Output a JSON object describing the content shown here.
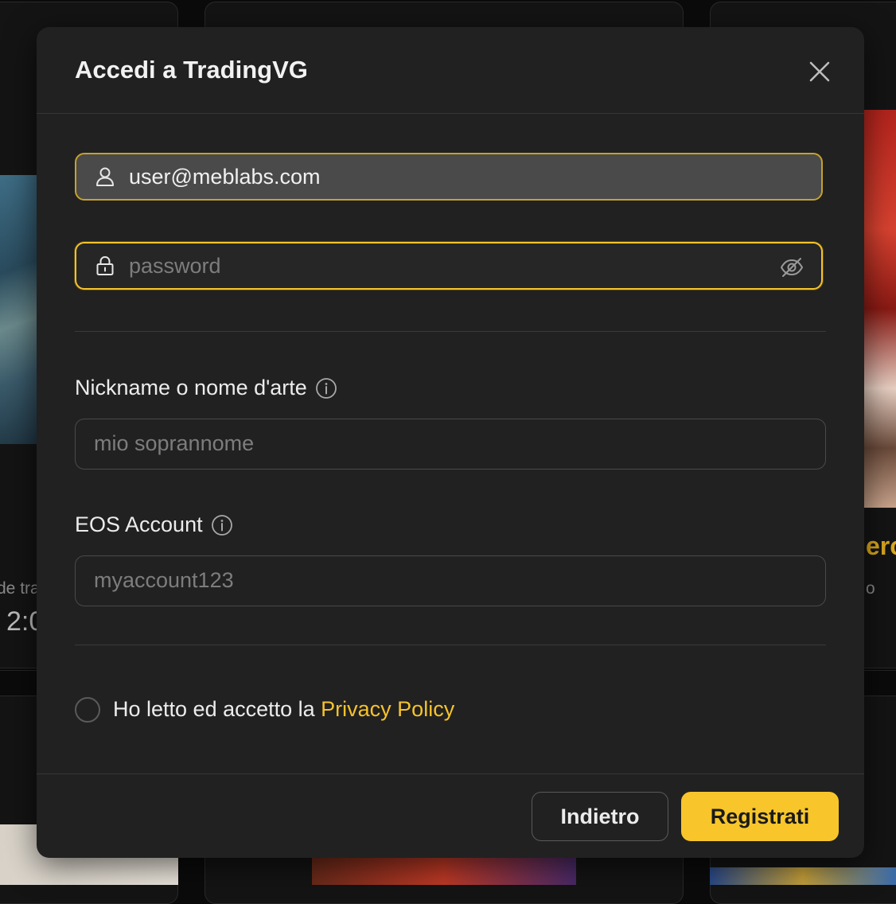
{
  "modal": {
    "title": "Accedi a TradingVG",
    "email_value": "user@meblabs.com",
    "password_placeholder": "password",
    "nickname_label": "Nickname o nome d'arte",
    "nickname_placeholder": "mio soprannome",
    "eos_label": "EOS Account",
    "eos_placeholder": "myaccount123",
    "consent_text": "Ho letto ed accetto la ",
    "privacy_link": "Privacy Policy",
    "back_button": "Indietro",
    "register_button": "Registrati"
  },
  "background": {
    "left_card_fragment": "de tra",
    "left_card_value_fragment": "2:0",
    "right_card_title_fragment": "ercl",
    "right_card_sub_fragment": "o"
  },
  "icons": {
    "close": "close-icon",
    "user": "user-icon",
    "lock": "lock-icon",
    "eye_off": "eye-off-icon",
    "info": "info-icon"
  },
  "colors": {
    "accent": "#f8c62b",
    "modal_bg": "#212121",
    "page_bg": "#0b0b0b"
  }
}
